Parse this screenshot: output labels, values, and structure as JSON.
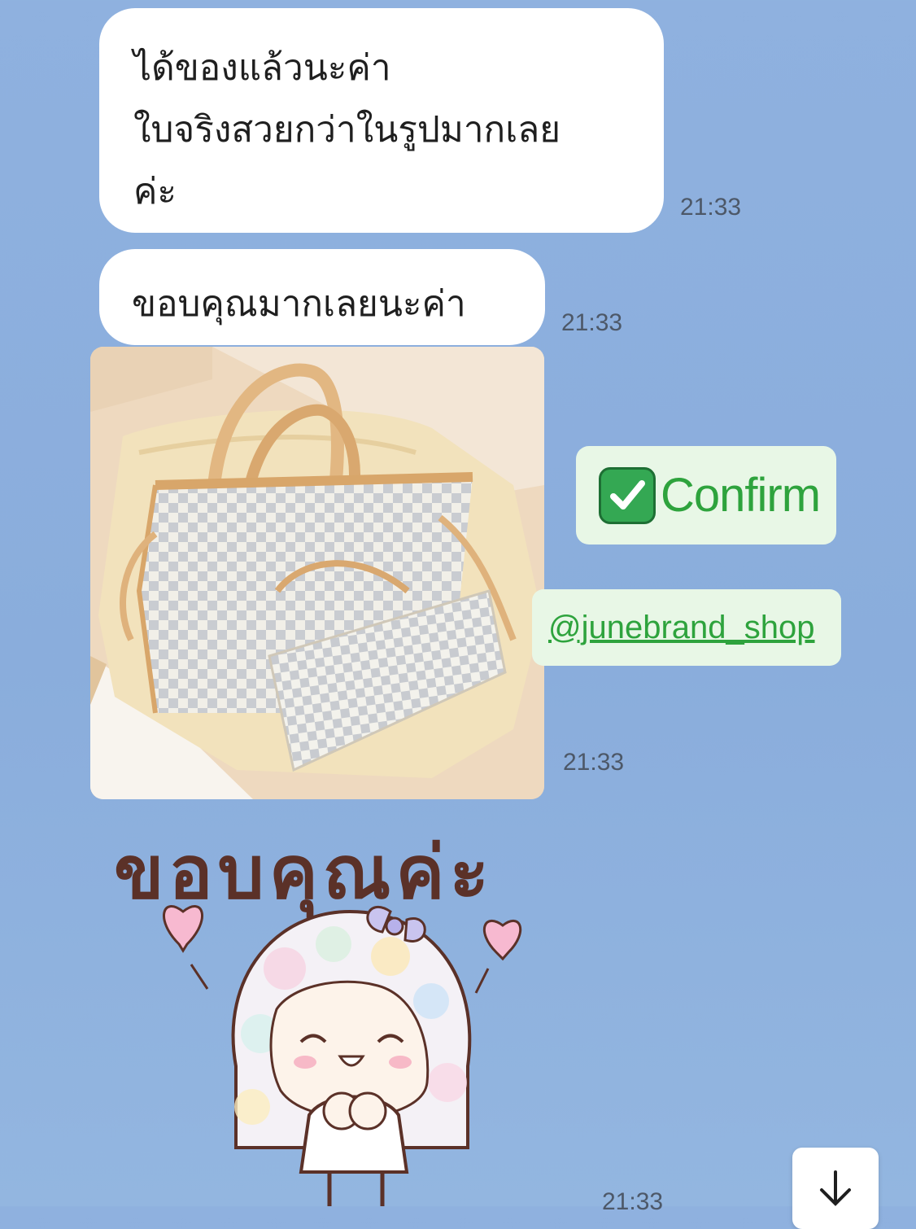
{
  "chat": {
    "messages": [
      {
        "lines": [
          "ได้ของแล้วนะค่า",
          "ใบจริงสวยกว่าในรูปมากเลย",
          "ค่ะ"
        ],
        "time": "21:33"
      },
      {
        "text": "ขอบคุณมากเลยนะค่า",
        "time": "21:33"
      }
    ],
    "photo": {
      "time": "21:33"
    },
    "overlay": {
      "confirm": "Confirm",
      "handle": "@junebrand_shop"
    },
    "sticker": {
      "caption": "ขอบคุณค่ะ",
      "time": "21:33"
    }
  },
  "icons": {
    "check": "check-mark-icon",
    "scroll": "arrow-down-icon"
  },
  "colors": {
    "background": "#8fb1df",
    "bubble": "#ffffff",
    "accent_green": "#2ea33d",
    "sticker_text": "#5b3128"
  }
}
